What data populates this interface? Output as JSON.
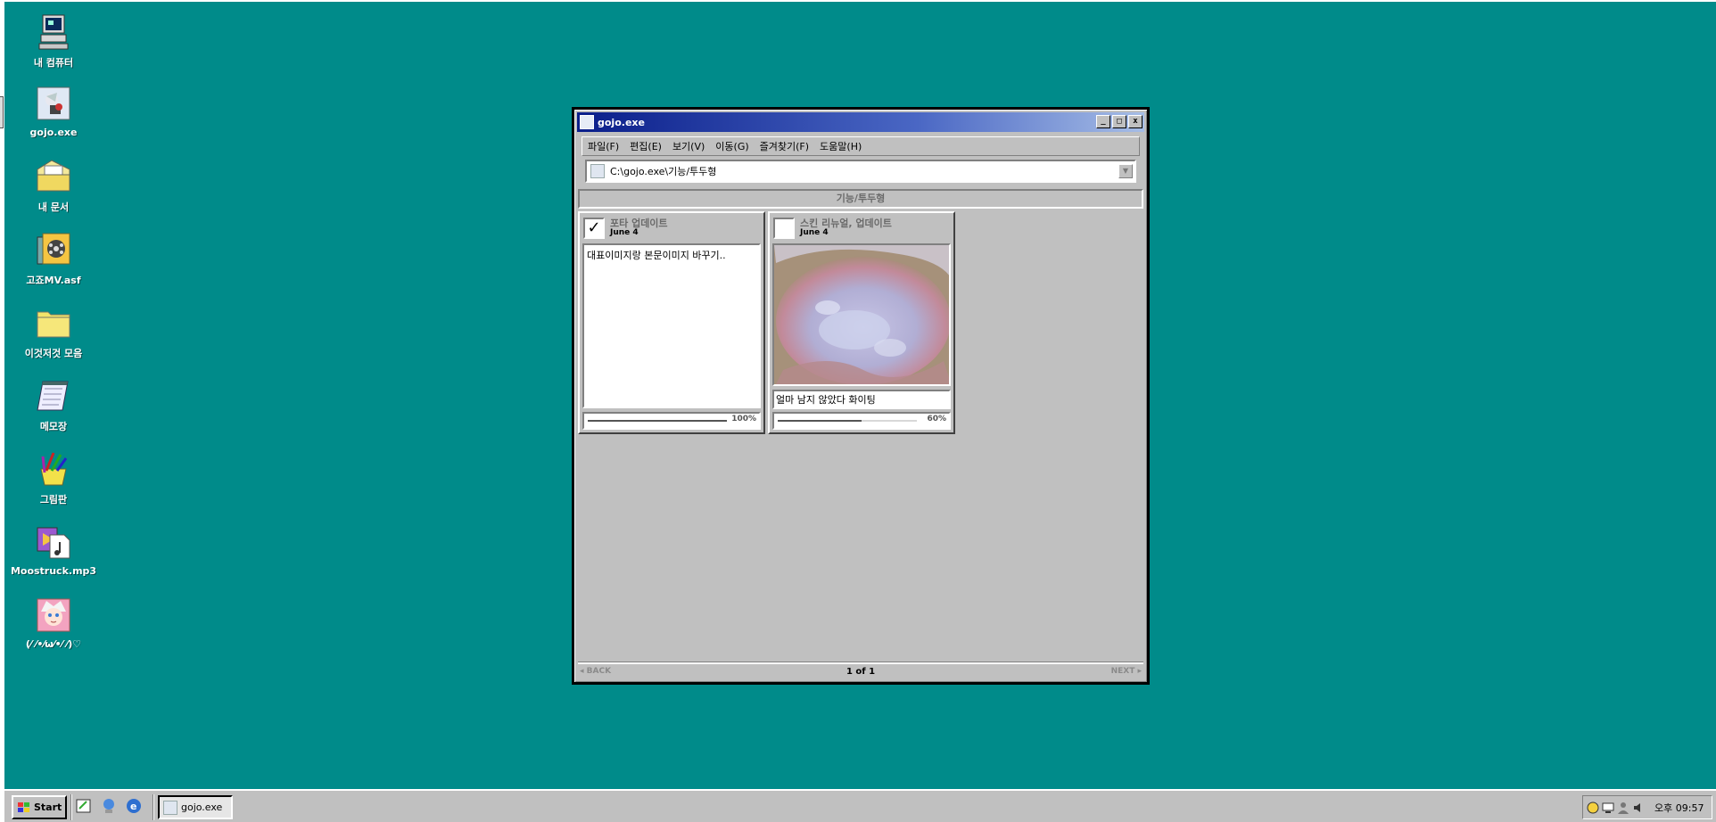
{
  "desktop": {
    "icons": [
      {
        "label": "내 컴퓨터",
        "icon": "my-computer-icon"
      },
      {
        "label": "gojo.exe",
        "icon": "gojo-exe-icon"
      },
      {
        "label": "내 문서",
        "icon": "my-documents-icon"
      },
      {
        "label": "고죠MV.asf",
        "icon": "video-file-icon"
      },
      {
        "label": "이것저것 모음",
        "icon": "folder-icon"
      },
      {
        "label": "메모장",
        "icon": "notepad-icon"
      },
      {
        "label": "그림판",
        "icon": "paint-icon"
      },
      {
        "label": "Moostruck.mp3",
        "icon": "audio-file-icon"
      },
      {
        "label": "(⁄ ⁄•⁄ω⁄•⁄ ⁄)♡",
        "icon": "character-icon"
      }
    ]
  },
  "window": {
    "title": "gojo.exe",
    "controls": [
      "_",
      "□",
      "x"
    ],
    "menu": [
      "파일(F)",
      "편집(E)",
      "보기(V)",
      "이동(G)",
      "즐겨찾기(F)",
      "도움말(H)"
    ],
    "address": "C:\\gojo.exe\\기능/투두형",
    "section_title": "기능/투두형",
    "cards": [
      {
        "title": "포타 업데이트",
        "date": "June 4",
        "checked": true,
        "check_mark": "✓",
        "body": "대표이미지랑 본문이미지 바꾸기..",
        "progress": 100,
        "progress_label": "100%"
      },
      {
        "title": "스킨 리뉴얼, 업데이트",
        "date": "June 4",
        "checked": false,
        "check_mark": "",
        "caption": "얼마 남지 않았다 화이팅",
        "progress": 60,
        "progress_label": "60%"
      }
    ],
    "footer": {
      "back": "◂ BACK",
      "page": "1 of 1",
      "next": "NEXT ▸"
    }
  },
  "taskbar": {
    "start_label": "Start",
    "task_label": "gojo.exe",
    "clock": "오후 09:57"
  },
  "colors": {
    "desktop": "#008b8a",
    "titlebar_start": "#0a1e8a",
    "window": "#c0c0c0"
  }
}
